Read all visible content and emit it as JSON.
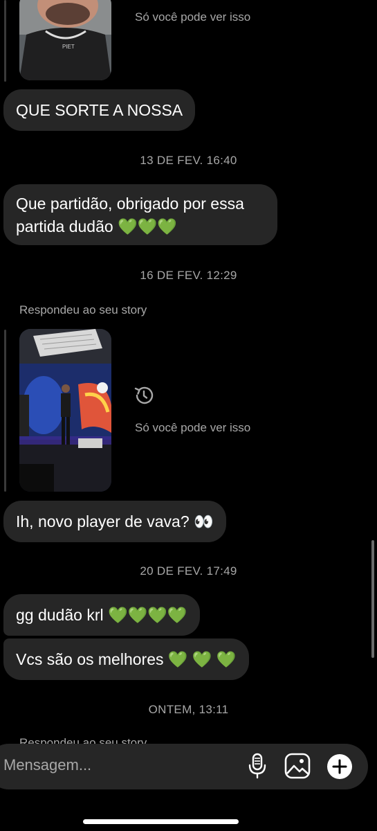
{
  "messages": {
    "only_you_1": "Só você pode ver isso",
    "m1": "QUE SORTE A NOSSA",
    "ts1": "13 DE FEV. 16:40",
    "m2_line1": "Que partidão, obrigado por essa",
    "m2_line2": "partida dudão",
    "ts2": "16 DE FEV. 12:29",
    "replied_1": "Respondeu ao seu story",
    "only_you_2": "Só você pode ver isso",
    "m3": "Ih, novo player de vava?",
    "ts3": "20 DE FEV. 17:49",
    "m4": "gg dudão krl",
    "m5": "Vcs são os melhores",
    "ts4": "ONTEM, 13:11",
    "replied_2": "Respondeu ao seu story"
  },
  "emoji": {
    "green_hearts_3": "💚💚💚",
    "green_hearts_4": "💚💚💚💚",
    "green_hearts_spaced": "💚 💚 💚",
    "eyes": "👀"
  },
  "composer": {
    "placeholder": "Mensagem..."
  },
  "icons": {
    "history": "history-icon",
    "mic": "microphone-icon",
    "gallery": "gallery-icon",
    "plus": "plus-icon"
  },
  "colors": {
    "background": "#000000",
    "bubble": "#262626",
    "muted_text": "#a8a8a8",
    "heart": "#43d15a"
  }
}
